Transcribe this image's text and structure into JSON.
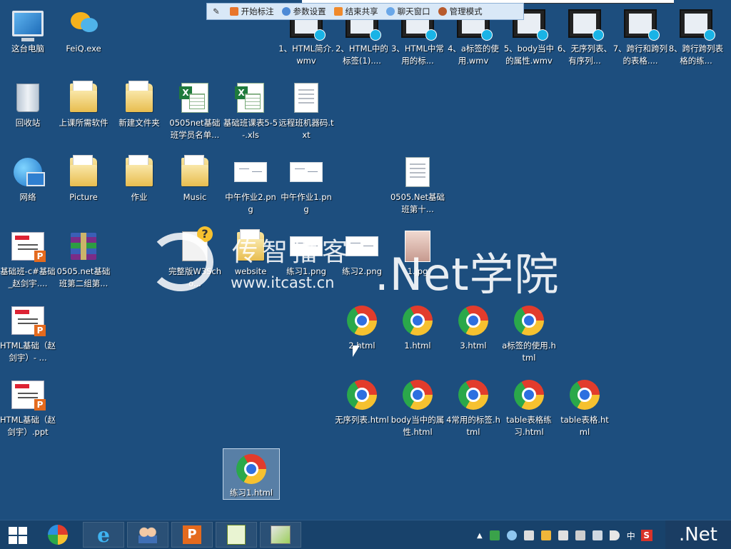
{
  "toolbar": {
    "items": [
      "开始标注",
      "参数设置",
      "结束共享",
      "聊天窗口",
      "管理模式"
    ]
  },
  "desktop": {
    "col1": [
      "这台电脑",
      "回收站",
      "网络",
      "基础班-c#基础_赵剑宇....",
      "HTML基础（赵剑宇）- ...",
      "HTML基础（赵剑宇）.ppt"
    ],
    "col2": [
      "FeiQ.exe",
      "上课所需软件",
      "Picture",
      "0505.net基础班第二组第..."
    ],
    "row2": [
      "新建文件夹",
      "0505net基础班学员名单...",
      "基础班课表5-5-.xls",
      "远程班机器码.txt"
    ],
    "row3": [
      "作业",
      "Music",
      "中午作业2.png",
      "中午作业1.png",
      "0505.Net基础班第十..."
    ],
    "row4": [
      "完整版W3Scho...",
      "website",
      "练习1.png",
      "练习2.png",
      "1.jpg"
    ],
    "videos": [
      "1、HTML简介.wmv",
      "2、HTML中的标签(1)....",
      "3、HTML中常用的标...",
      "4、a标签的使用.wmv",
      "5、body当中的属性.wmv",
      "6、无序列表、有序列...",
      "7、跨行和跨列的表格....",
      "8、跨行跨列表格的练..."
    ],
    "html_row1": [
      "2.html",
      "1.html",
      "3.html",
      "a标签的使用.html"
    ],
    "html_row2": [
      "无序列表.html",
      "body当中的属性.html",
      "4常用的标签.html",
      "table表格练习.html",
      "table表格.html"
    ],
    "selected_file": "练习1.html"
  },
  "watermark": {
    "chinese": "传智播客",
    "url": "www.itcast.cn",
    "academy": ".Net学院"
  },
  "taskbar": {
    "apps": [
      "internet-explorer",
      "feiq-users",
      "wps-presentation",
      "notepad-plus",
      "winrar-installer"
    ],
    "ime": "中",
    "sogou": "S",
    "brand": ".Net"
  }
}
